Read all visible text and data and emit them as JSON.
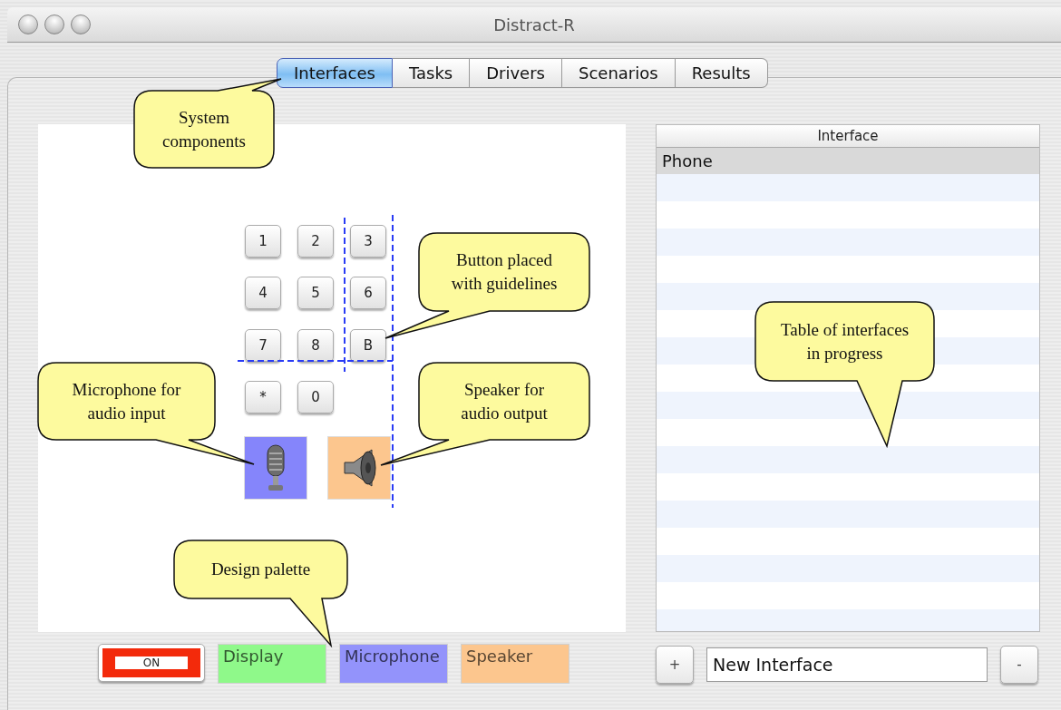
{
  "window": {
    "title": "Distract-R"
  },
  "tabs": [
    {
      "label": "Interfaces",
      "selected": true
    },
    {
      "label": "Tasks",
      "selected": false
    },
    {
      "label": "Drivers",
      "selected": false
    },
    {
      "label": "Scenarios",
      "selected": false
    },
    {
      "label": "Results",
      "selected": false
    }
  ],
  "canvas": {
    "components": [
      {
        "kind": "key",
        "label": "1"
      },
      {
        "kind": "key",
        "label": "2"
      },
      {
        "kind": "key",
        "label": "3"
      },
      {
        "kind": "key",
        "label": "4"
      },
      {
        "kind": "key",
        "label": "5"
      },
      {
        "kind": "key",
        "label": "6"
      },
      {
        "kind": "key",
        "label": "7"
      },
      {
        "kind": "key",
        "label": "8"
      },
      {
        "kind": "key",
        "label": "B"
      },
      {
        "kind": "key",
        "label": "*"
      },
      {
        "kind": "key",
        "label": "0"
      },
      {
        "kind": "microphone",
        "color": "#8585fb"
      },
      {
        "kind": "speaker",
        "color": "#fcc68e"
      }
    ]
  },
  "palette": [
    {
      "kind": "toggle",
      "label": "ON"
    },
    {
      "kind": "tile",
      "label": "Display",
      "color": "#8ff98a"
    },
    {
      "kind": "tile",
      "label": "Microphone",
      "color": "#9393fb"
    },
    {
      "kind": "tile",
      "label": "Speaker",
      "color": "#fcc68e"
    }
  ],
  "table": {
    "columns": [
      "Interface"
    ],
    "rows": [
      {
        "cells": [
          "Phone"
        ],
        "selected": true
      }
    ]
  },
  "controls": {
    "add": "+",
    "name_field": {
      "value": "New Interface"
    },
    "remove": "-"
  },
  "callouts": [
    {
      "text": "System components"
    },
    {
      "text": "Button placed with guidelines"
    },
    {
      "text": "Microphone for audio input"
    },
    {
      "text": "Speaker for audio output"
    },
    {
      "text": "Table of interfaces in progress"
    },
    {
      "text": "Design palette"
    }
  ]
}
